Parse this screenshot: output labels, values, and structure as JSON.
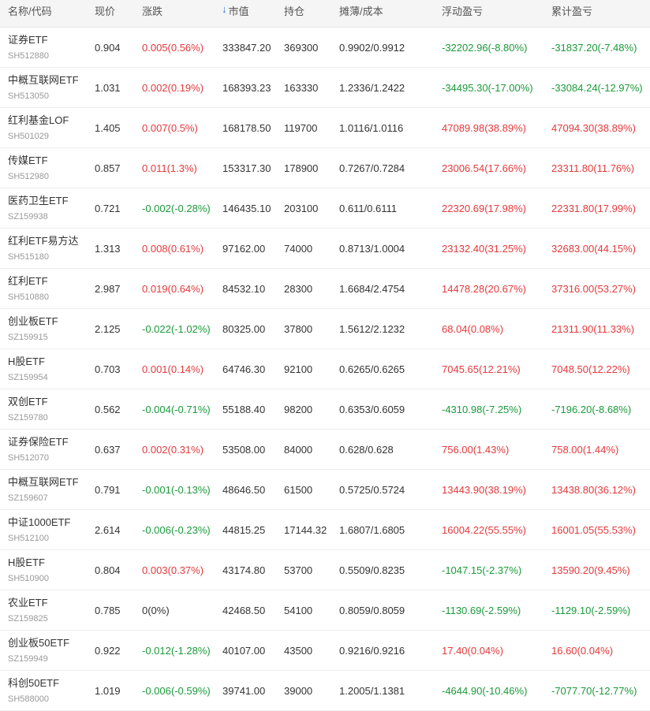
{
  "headers": {
    "name": "名称/代码",
    "price": "现价",
    "change": "涨跌",
    "market_value": "市值",
    "holding": "持仓",
    "cost": "摊薄/成本",
    "floating_pl": "浮动盈亏",
    "total_pl": "累计盈亏",
    "sort_icon": "arrow-down"
  },
  "colors": {
    "up": "#e4393c",
    "down": "#1a9a3a",
    "sort": "#2a6fdb"
  },
  "rows": [
    {
      "name": "证券ETF",
      "code": "SH512880",
      "price": "0.904",
      "change": "0.005(0.56%)",
      "change_dir": "up",
      "market_value": "333847.20",
      "holding": "369300",
      "cost": "0.9902/0.9912",
      "floating_pl": "-32202.96(-8.80%)",
      "floating_dir": "down",
      "total_pl": "-31837.20(-7.48%)",
      "total_dir": "down"
    },
    {
      "name": "中概互联网ETF",
      "code": "SH513050",
      "price": "1.031",
      "change": "0.002(0.19%)",
      "change_dir": "up",
      "market_value": "168393.23",
      "holding": "163330",
      "cost": "1.2336/1.2422",
      "floating_pl": "-34495.30(-17.00%)",
      "floating_dir": "down",
      "total_pl": "-33084.24(-12.97%)",
      "total_dir": "down"
    },
    {
      "name": "红利基金LOF",
      "code": "SH501029",
      "price": "1.405",
      "change": "0.007(0.5%)",
      "change_dir": "up",
      "market_value": "168178.50",
      "holding": "119700",
      "cost": "1.0116/1.0116",
      "floating_pl": "47089.98(38.89%)",
      "floating_dir": "up",
      "total_pl": "47094.30(38.89%)",
      "total_dir": "up"
    },
    {
      "name": "传媒ETF",
      "code": "SH512980",
      "price": "0.857",
      "change": "0.011(1.3%)",
      "change_dir": "up",
      "market_value": "153317.30",
      "holding": "178900",
      "cost": "0.7267/0.7284",
      "floating_pl": "23006.54(17.66%)",
      "floating_dir": "up",
      "total_pl": "23311.80(11.76%)",
      "total_dir": "up"
    },
    {
      "name": "医药卫生ETF",
      "code": "SZ159938",
      "price": "0.721",
      "change": "-0.002(-0.28%)",
      "change_dir": "down",
      "market_value": "146435.10",
      "holding": "203100",
      "cost": "0.611/0.6111",
      "floating_pl": "22320.69(17.98%)",
      "floating_dir": "up",
      "total_pl": "22331.80(17.99%)",
      "total_dir": "up"
    },
    {
      "name": "红利ETF易方达",
      "code": "SH515180",
      "price": "1.313",
      "change": "0.008(0.61%)",
      "change_dir": "up",
      "market_value": "97162.00",
      "holding": "74000",
      "cost": "0.8713/1.0004",
      "floating_pl": "23132.40(31.25%)",
      "floating_dir": "up",
      "total_pl": "32683.00(44.15%)",
      "total_dir": "up"
    },
    {
      "name": "红利ETF",
      "code": "SH510880",
      "price": "2.987",
      "change": "0.019(0.64%)",
      "change_dir": "up",
      "market_value": "84532.10",
      "holding": "28300",
      "cost": "1.6684/2.4754",
      "floating_pl": "14478.28(20.67%)",
      "floating_dir": "up",
      "total_pl": "37316.00(53.27%)",
      "total_dir": "up"
    },
    {
      "name": "创业板ETF",
      "code": "SZ159915",
      "price": "2.125",
      "change": "-0.022(-1.02%)",
      "change_dir": "down",
      "market_value": "80325.00",
      "holding": "37800",
      "cost": "1.5612/2.1232",
      "floating_pl": "68.04(0.08%)",
      "floating_dir": "up",
      "total_pl": "21311.90(11.33%)",
      "total_dir": "up"
    },
    {
      "name": "H股ETF",
      "code": "SZ159954",
      "price": "0.703",
      "change": "0.001(0.14%)",
      "change_dir": "up",
      "market_value": "64746.30",
      "holding": "92100",
      "cost": "0.6265/0.6265",
      "floating_pl": "7045.65(12.21%)",
      "floating_dir": "up",
      "total_pl": "7048.50(12.22%)",
      "total_dir": "up"
    },
    {
      "name": "双创ETF",
      "code": "SZ159780",
      "price": "0.562",
      "change": "-0.004(-0.71%)",
      "change_dir": "down",
      "market_value": "55188.40",
      "holding": "98200",
      "cost": "0.6353/0.6059",
      "floating_pl": "-4310.98(-7.25%)",
      "floating_dir": "down",
      "total_pl": "-7196.20(-8.68%)",
      "total_dir": "down"
    },
    {
      "name": "证券保险ETF",
      "code": "SH512070",
      "price": "0.637",
      "change": "0.002(0.31%)",
      "change_dir": "up",
      "market_value": "53508.00",
      "holding": "84000",
      "cost": "0.628/0.628",
      "floating_pl": "756.00(1.43%)",
      "floating_dir": "up",
      "total_pl": "758.00(1.44%)",
      "total_dir": "up"
    },
    {
      "name": "中概互联网ETF",
      "code": "SZ159607",
      "price": "0.791",
      "change": "-0.001(-0.13%)",
      "change_dir": "down",
      "market_value": "48646.50",
      "holding": "61500",
      "cost": "0.5725/0.5724",
      "floating_pl": "13443.90(38.19%)",
      "floating_dir": "up",
      "total_pl": "13438.80(36.12%)",
      "total_dir": "up"
    },
    {
      "name": "中证1000ETF",
      "code": "SH512100",
      "price": "2.614",
      "change": "-0.006(-0.23%)",
      "change_dir": "down",
      "market_value": "44815.25",
      "holding": "17144.32",
      "cost": "1.6807/1.6805",
      "floating_pl": "16004.22(55.55%)",
      "floating_dir": "up",
      "total_pl": "16001.05(55.53%)",
      "total_dir": "up"
    },
    {
      "name": "H股ETF",
      "code": "SH510900",
      "price": "0.804",
      "change": "0.003(0.37%)",
      "change_dir": "up",
      "market_value": "43174.80",
      "holding": "53700",
      "cost": "0.5509/0.8235",
      "floating_pl": "-1047.15(-2.37%)",
      "floating_dir": "down",
      "total_pl": "13590.20(9.45%)",
      "total_dir": "up"
    },
    {
      "name": "农业ETF",
      "code": "SZ159825",
      "price": "0.785",
      "change": "0(0%)",
      "change_dir": "flat",
      "market_value": "42468.50",
      "holding": "54100",
      "cost": "0.8059/0.8059",
      "floating_pl": "-1130.69(-2.59%)",
      "floating_dir": "down",
      "total_pl": "-1129.10(-2.59%)",
      "total_dir": "down"
    },
    {
      "name": "创业板50ETF",
      "code": "SZ159949",
      "price": "0.922",
      "change": "-0.012(-1.28%)",
      "change_dir": "down",
      "market_value": "40107.00",
      "holding": "43500",
      "cost": "0.9216/0.9216",
      "floating_pl": "17.40(0.04%)",
      "floating_dir": "up",
      "total_pl": "16.60(0.04%)",
      "total_dir": "up"
    },
    {
      "name": "科创50ETF",
      "code": "SH588000",
      "price": "1.019",
      "change": "-0.006(-0.59%)",
      "change_dir": "down",
      "market_value": "39741.00",
      "holding": "39000",
      "cost": "1.2005/1.1381",
      "floating_pl": "-4644.90(-10.46%)",
      "floating_dir": "down",
      "total_pl": "-7077.70(-12.77%)",
      "total_dir": "down"
    }
  ]
}
